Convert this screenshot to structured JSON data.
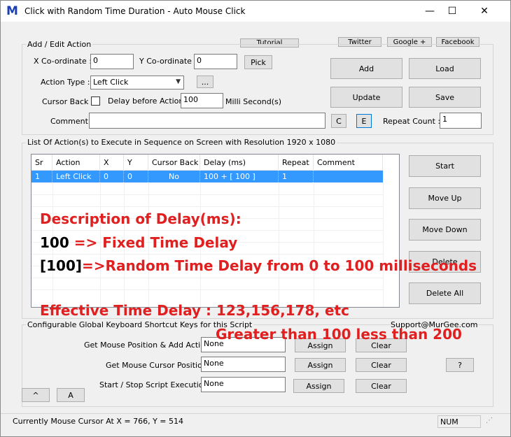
{
  "window": {
    "title": "Click with Random Time Duration - Auto Mouse Click",
    "icon_letter": "M",
    "minimize_glyph": "—",
    "maximize_glyph": "☐",
    "close_glyph": "✕"
  },
  "top_links": {
    "tutorial": "Tutorial",
    "twitter": "Twitter",
    "google": "Google +",
    "facebook": "Facebook"
  },
  "add_edit": {
    "group_label": "Add / Edit Action",
    "x_label": "X Co-ordinate :",
    "x_value": "0",
    "y_label": "Y Co-ordinate :",
    "y_value": "0",
    "pick_label": "Pick",
    "action_type_label": "Action Type :",
    "action_type_value": "Left Click",
    "ellipsis_label": "...",
    "cursor_back_label": "Cursor Back :",
    "delay_label": "Delay before Action :",
    "delay_value": "100",
    "delay_unit": "Milli Second(s)",
    "comment_label": "Comment :",
    "comment_value": "",
    "c_label": "C",
    "e_label": "E",
    "repeat_label": "Repeat Count :",
    "repeat_value": "1"
  },
  "actions": {
    "add": "Add",
    "load": "Load",
    "update": "Update",
    "save": "Save"
  },
  "list": {
    "group_label": "List Of Action(s) to Execute in Sequence on Screen with Resolution 1920 x 1080",
    "columns": [
      "Sr",
      "Action",
      "X",
      "Y",
      "Cursor Back",
      "Delay (ms)",
      "Repeat",
      "Comment"
    ],
    "rows": [
      [
        "1",
        "Left Click",
        "0",
        "0",
        "No",
        "100 + [ 100 ]",
        "1",
        ""
      ]
    ]
  },
  "side_buttons": {
    "start": "Start",
    "move_up": "Move Up",
    "move_down": "Move Down",
    "delete": "Delete",
    "delete_all": "Delete All"
  },
  "overlay": {
    "line1": "Description of Delay(ms):",
    "line2_num": "100",
    "line2_text": " => Fixed Time Delay",
    "line3_num": "[100]",
    "line3_text": "=>Random Time Delay from 0 to 100 milliseconds",
    "line4": "Effective Time Delay : 123,156,178, etc",
    "line5": "Greater than 100 less than 200"
  },
  "shortcuts": {
    "group_label": "Configurable Global Keyboard Shortcut Keys for this Script",
    "support": "Support@MurGee.com",
    "get_pos_label": "Get Mouse Position & Add Action :",
    "get_pos_value": "None",
    "get_cursor_label": "Get Mouse Cursor Position :",
    "get_cursor_value": "None",
    "start_stop_label": "Start / Stop Script Execution :",
    "start_stop_value": "None",
    "assign": "Assign",
    "clear": "Clear",
    "help": "?"
  },
  "bottom_buttons": {
    "caret": "^",
    "a": "A"
  },
  "status": {
    "cursor_text": "Currently Mouse Cursor At X = 766, Y = 514",
    "num": "NUM"
  }
}
